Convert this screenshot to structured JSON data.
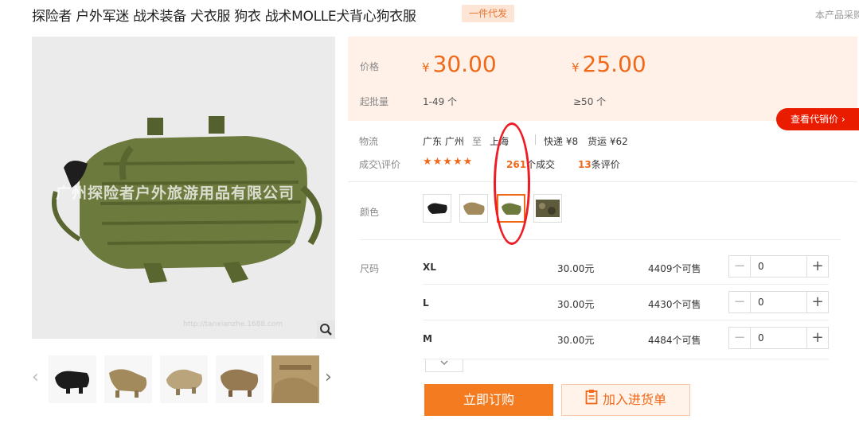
{
  "product": {
    "title": "探险者 户外军迷 战术装备 犬衣服 狗衣 战术MOLLE犬背心狗衣服",
    "dropship_tag": "一件代发",
    "top_right_note": "本产品采购",
    "watermark": "广州探险者户外旅游用品有限公司",
    "watermark_url": "http://tanxianzhe.1688.com"
  },
  "pricing": {
    "price_label": "价格",
    "batch_label": "起批量",
    "tiers": [
      {
        "currency": "¥",
        "price": "30.00",
        "range": "1-49 个"
      },
      {
        "currency": "¥",
        "price": "25.00",
        "range": "≥50 个"
      }
    ]
  },
  "promo_button": "查看代销价 ›",
  "logistics": {
    "label": "物流",
    "from": "广东 广州",
    "to_word": "至",
    "to": "上海",
    "express": "快递 ¥8",
    "freight": "货运 ¥62"
  },
  "deals": {
    "label": "成交\\评价",
    "stars": "★★★★★",
    "count": "261",
    "count_suffix": "个成交",
    "reviews": "13",
    "reviews_suffix": "条评价"
  },
  "color": {
    "label": "颜色",
    "options": [
      "black",
      "tan",
      "olive",
      "camo"
    ],
    "selected": 2
  },
  "sizes": {
    "label": "尺码",
    "rows": [
      {
        "name": "XL",
        "price": "30.00元",
        "stock": "4409个可售",
        "qty": "0"
      },
      {
        "name": "L",
        "price": "30.00元",
        "stock": "4430个可售",
        "qty": "0"
      },
      {
        "name": "M",
        "price": "30.00元",
        "stock": "4484个可售",
        "qty": "0"
      }
    ]
  },
  "actions": {
    "buy_now": "立即订购",
    "add_to_cart": "加入进货单"
  },
  "colors": {
    "accent": "#f0691a",
    "price_panel_bg": "#fff1e8",
    "promo_red": "#ea1c00",
    "annotation": "#ee1c25"
  }
}
